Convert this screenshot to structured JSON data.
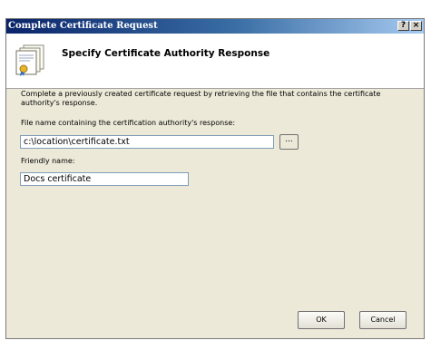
{
  "window": {
    "title": "Complete Certificate Request",
    "help_label": "?",
    "close_label": "×"
  },
  "header": {
    "heading": "Specify Certificate Authority Response",
    "icon": "certificate-icon"
  },
  "description": "Complete a previously created certificate request by retrieving the file that contains the certificate authority's response.",
  "file_field": {
    "label": "File name containing the certification authority's response:",
    "value": "c:\\location\\certificate.txt",
    "browse_label": "..."
  },
  "friendly_field": {
    "label": "Friendly name:",
    "value": "Docs certificate"
  },
  "buttons": {
    "ok": "OK",
    "cancel": "Cancel"
  }
}
